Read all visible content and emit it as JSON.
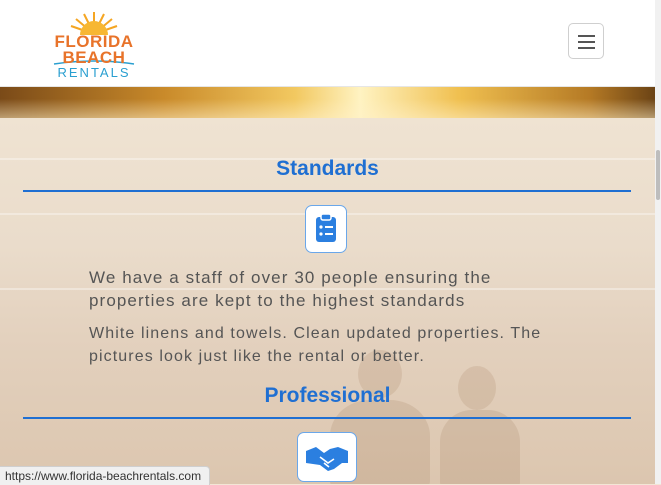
{
  "header": {
    "logo": {
      "line1": "FLORIDA",
      "line2": "BEACH",
      "line3": "RENTALS"
    }
  },
  "sections": [
    {
      "title": "Standards",
      "icon": "clipboard-list-icon",
      "paragraphs": [
        "We have a staff of over 30 people ensuring the properties are kept to the highest standards",
        "White linens and towels. Clean updated properties. The pictures look just like the rental or better."
      ]
    },
    {
      "title": "Professional",
      "icon": "handshake-icon"
    }
  ],
  "status_bar": {
    "url": "https://www.florida-beachrentals.com"
  },
  "colors": {
    "accent": "#1f6fd2",
    "logo_orange": "#e8732a",
    "logo_blue": "#2a9fd0"
  }
}
